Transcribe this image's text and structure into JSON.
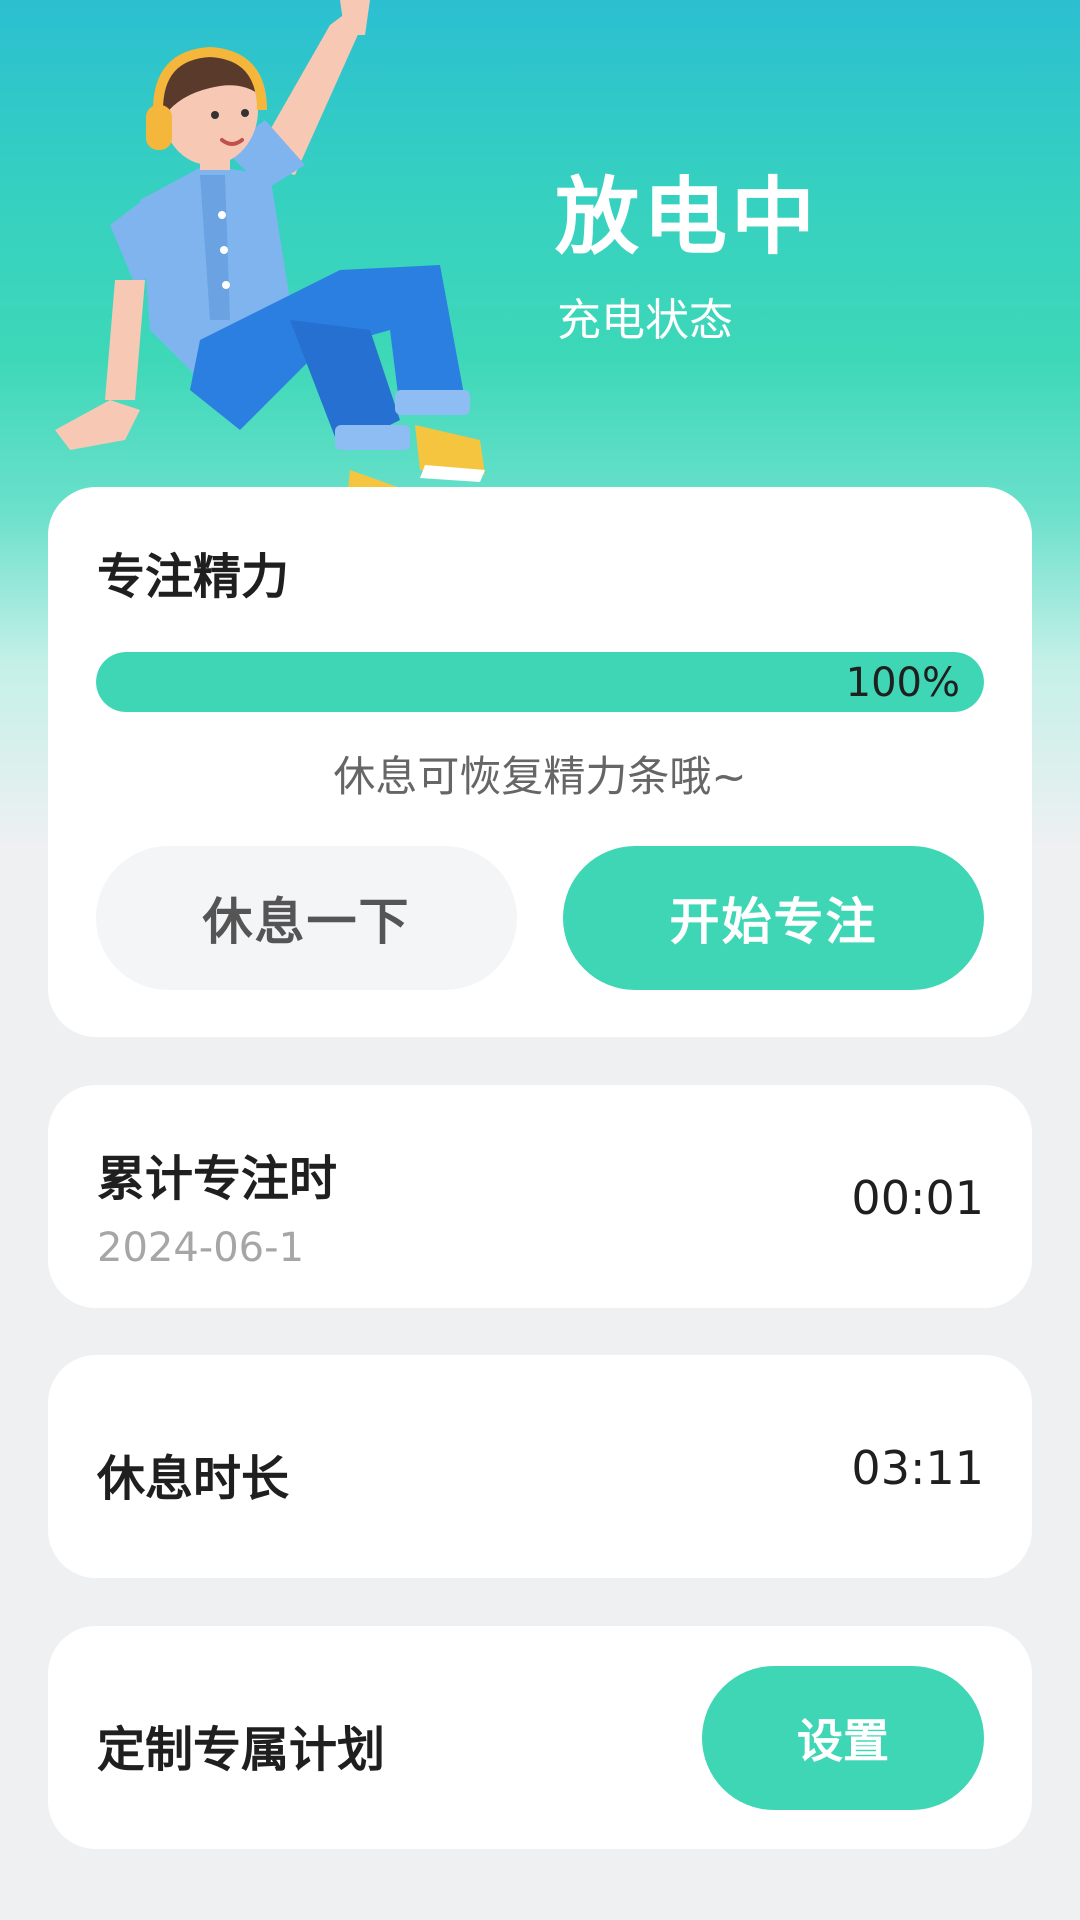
{
  "header": {
    "title": "放电中",
    "subtitle": "充电状态"
  },
  "energy": {
    "title": "专注精力",
    "progress_percent": 100,
    "progress_label": "100%",
    "hint": "休息可恢复精力条哦~",
    "rest_button": "休息一下",
    "focus_button": "开始专注"
  },
  "total_focus": {
    "title": "累计专注时",
    "date": "2024-06-1",
    "value": "00:01"
  },
  "rest_duration": {
    "title": "休息时长",
    "value": "03:11"
  },
  "plan": {
    "title": "定制专属计划",
    "button": "设置"
  },
  "colors": {
    "accent": "#3fd6b5",
    "header_top": "#2bbfd1",
    "background": "#eff0f2"
  },
  "icons": {
    "hero": "boy-with-headphones-illustration"
  }
}
